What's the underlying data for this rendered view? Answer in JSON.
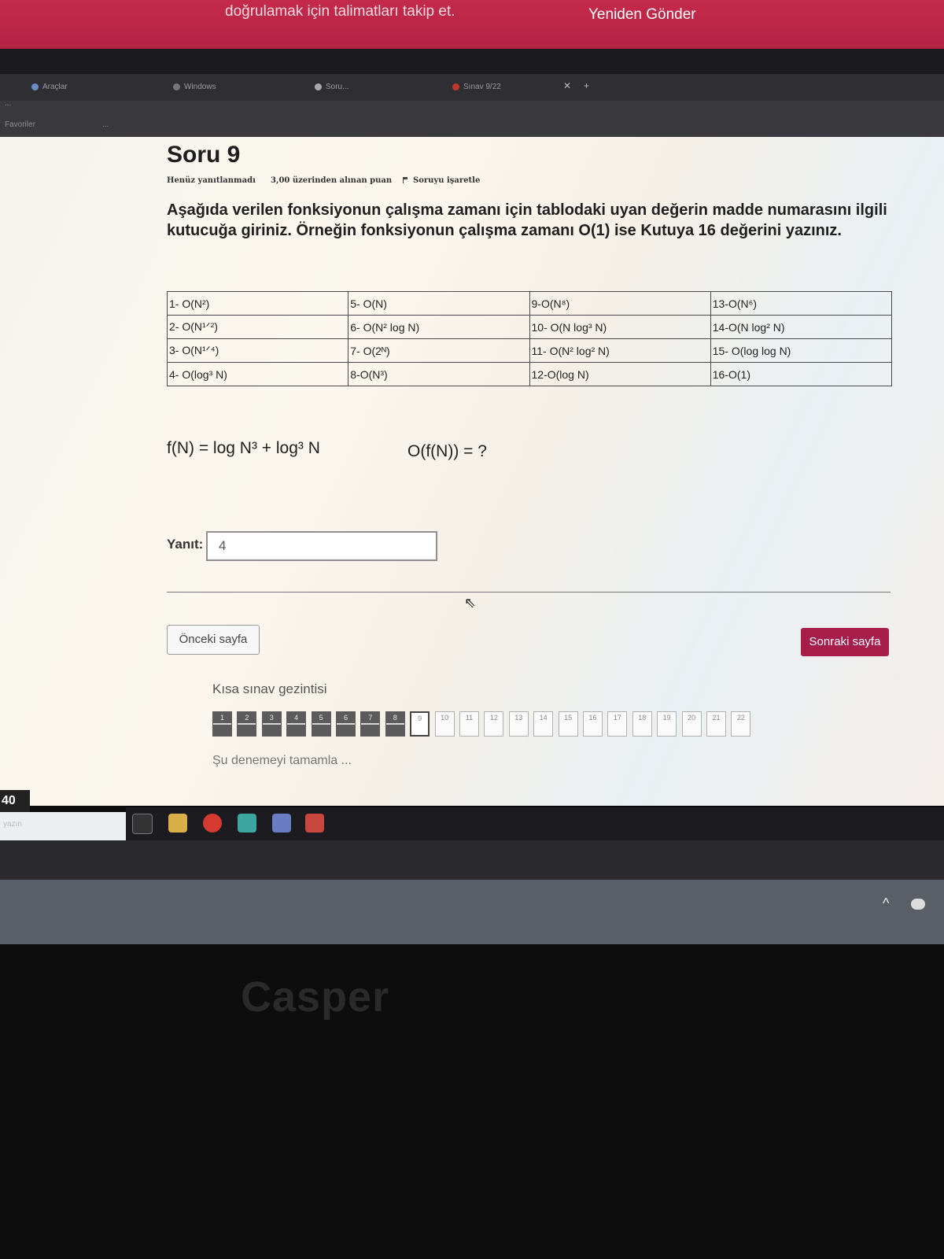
{
  "notification": {
    "message": "doğrulamak için talimatları takip et.",
    "resend_label": "Yeniden Gönder"
  },
  "browser": {
    "tabs": [
      "Araçlar",
      "Windows",
      "Soru...",
      "Sınav 9/22"
    ],
    "url": "...",
    "bookmarks": [
      "Favoriler",
      "..."
    ]
  },
  "question": {
    "title": "Soru 9",
    "status": "Henüz yanıtlanmadı",
    "points": "3,00 üzerinden alınan puan",
    "flag_label": "Soruyu işaretle",
    "text": "Aşağıda verilen fonksiyonun çalışma zamanı için tablodaki uyan değerin madde numarasını ilgili kutucuğa giriniz. Örneğin fonksiyonun çalışma zamanı O(1) ise Kutuya 16 değerini yazınız.",
    "options": [
      [
        "1- O(N²)",
        "5- O(N)",
        "9-O(N⁸)",
        "13-O(N⁶)"
      ],
      [
        "2- O(N¹ᐟ²)",
        "6- O(N² log N)",
        "10- O(N log³ N)",
        "14-O(N log² N)"
      ],
      [
        "3- O(N¹ᐟ⁴)",
        "7- O(2ᴺ)",
        "11- O(N² log² N)",
        "15- O(log log N)"
      ],
      [
        "4- O(log³ N)",
        "8-O(N³)",
        "12-O(log N)",
        "16-O(1)"
      ]
    ],
    "formula": "f(N) = log N³  + log³ N",
    "formula_query": "O(f(N)) = ?",
    "answer_label": "Yanıt:",
    "answer_value": "4"
  },
  "navigation": {
    "prev_label": "Önceki sayfa",
    "next_label": "Sonraki sayfa",
    "quiz_nav_title": "Kısa sınav gezintisi",
    "items": [
      "1",
      "2",
      "3",
      "4",
      "5",
      "6",
      "7",
      "8",
      "9",
      "10",
      "11",
      "12",
      "13",
      "14",
      "15",
      "16",
      "17",
      "18",
      "19",
      "20",
      "21",
      "22"
    ],
    "answered_count": 8,
    "current": 9,
    "finish_label": "Şu denemeyi tamamla ..."
  },
  "taskbar": {
    "left_number": "40",
    "search_hint": "yazın"
  },
  "laptop": {
    "brand": "Casper"
  },
  "colors": {
    "accent": "#a81e4a",
    "banner": "#c42a4a"
  }
}
